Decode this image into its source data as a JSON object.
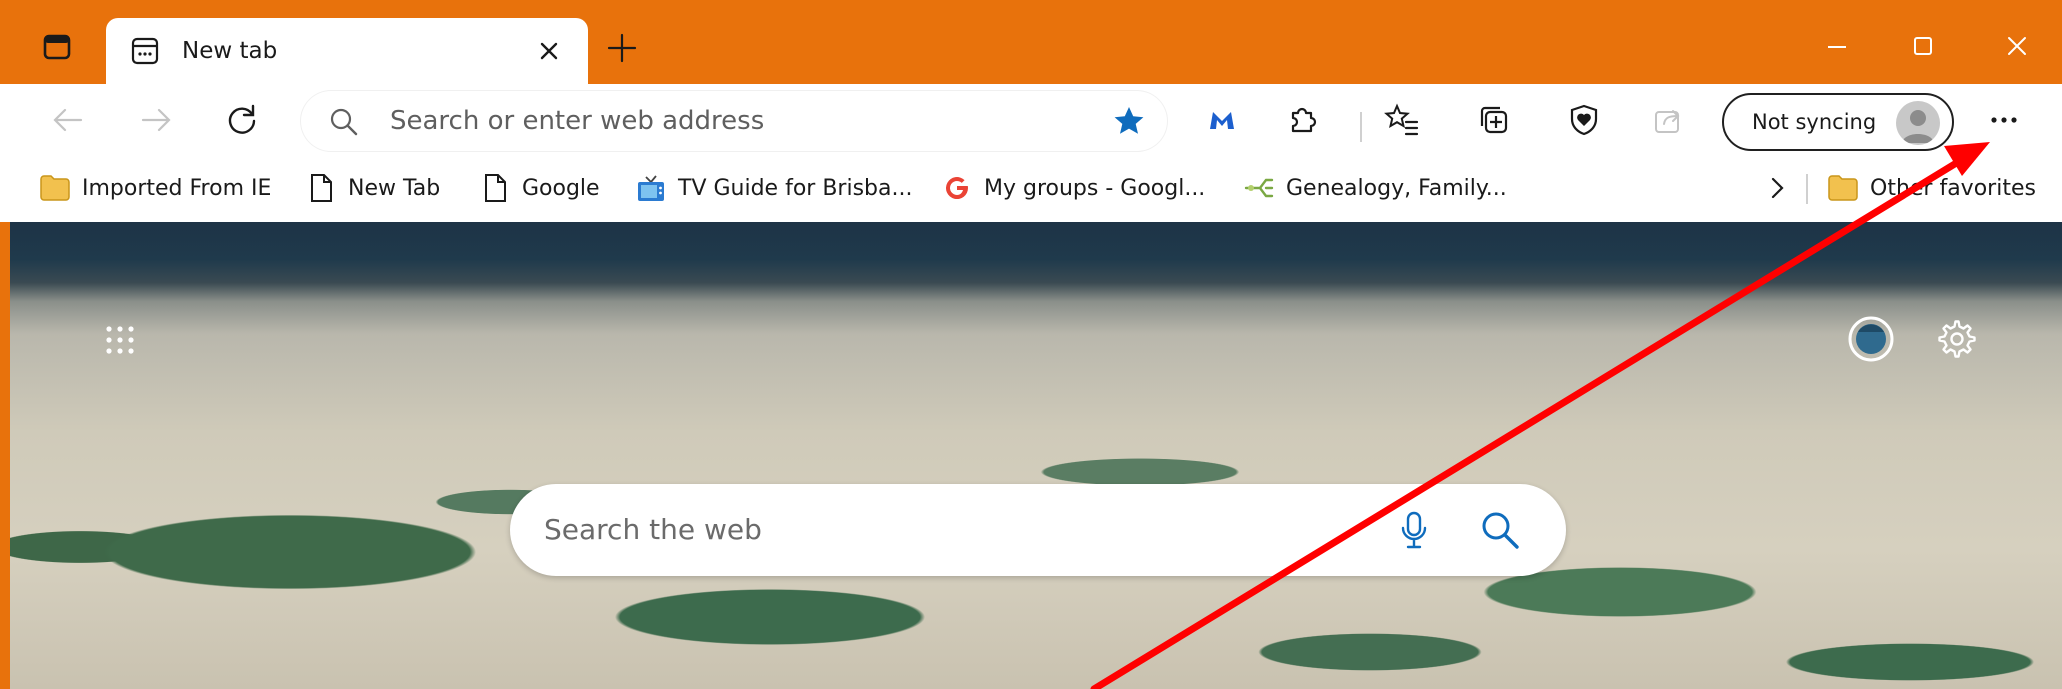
{
  "window": {
    "frame_color": "#e8720c",
    "accent_blue": "#0f6cbd"
  },
  "tab": {
    "title": "New tab",
    "icon": "new-tab-page-icon"
  },
  "addressbar": {
    "placeholder": "Search or enter web address"
  },
  "profile": {
    "label": "Not syncing"
  },
  "bookmarks": {
    "items": [
      {
        "label": "Imported From IE",
        "icon": "folder-icon"
      },
      {
        "label": "New Tab",
        "icon": "page-icon"
      },
      {
        "label": "Google",
        "icon": "page-icon"
      },
      {
        "label": "TV Guide for Brisba...",
        "icon": "tv-icon"
      },
      {
        "label": "My groups - Googl...",
        "icon": "google-g-icon"
      },
      {
        "label": "Genealogy, Family...",
        "icon": "tree-icon"
      }
    ],
    "other_favorites": "Other favorites"
  },
  "newtab": {
    "search_placeholder": "Search the web"
  },
  "annotation": {
    "color": "#ff0000"
  }
}
